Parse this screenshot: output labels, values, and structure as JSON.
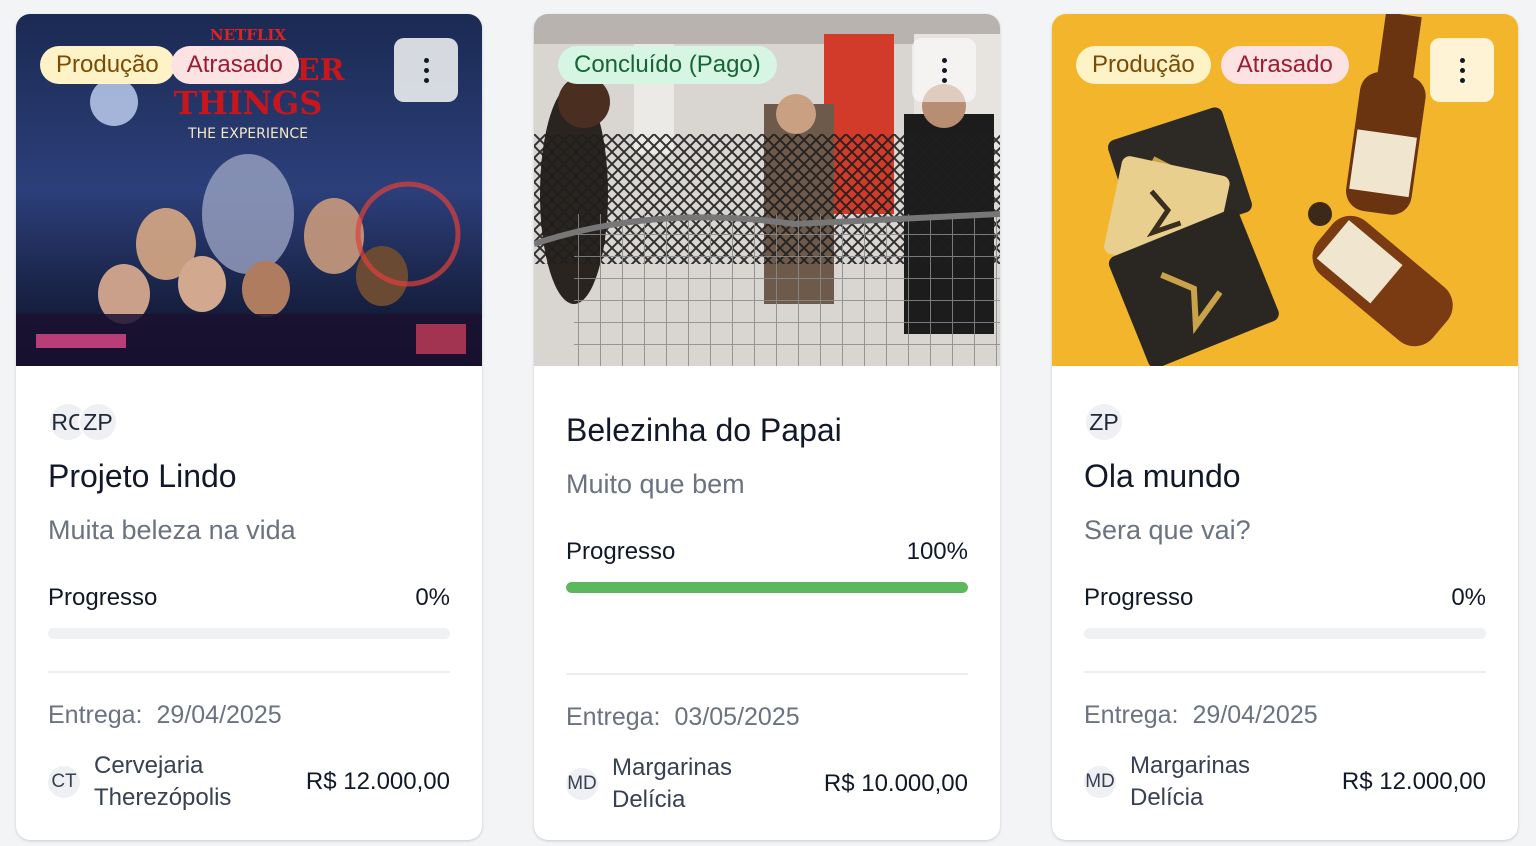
{
  "colors": {
    "badge_production_bg": "#fef3c7",
    "badge_production_fg": "#7c4a03",
    "badge_late_bg": "#fde2e4",
    "badge_late_fg": "#9b1c31",
    "badge_done_bg": "#d6f5e3",
    "badge_done_fg": "#166534",
    "progress_fill": "#5cb85c"
  },
  "progress_label": "Progresso",
  "delivery_label": "Entrega:",
  "cards": [
    {
      "image": "stranger-things-poster",
      "badges": [
        "Produção",
        "Atrasado"
      ],
      "avatars": [
        "RC",
        "ZP"
      ],
      "title": "Projeto Lindo",
      "subtitle": "Muita beleza na vida",
      "progress_text": "0%",
      "progress_value": 0,
      "delivery_date": "29/04/2025",
      "client_initials": "CT",
      "client_name": "Cervejaria Therezópolis",
      "price": "R$ 12.000,00"
    },
    {
      "image": "people-with-net-photo",
      "badges": [
        "Concluído (Pago)"
      ],
      "avatars": [],
      "title": "Belezinha do Papai",
      "subtitle": "Muito que bem",
      "progress_text": "100%",
      "progress_value": 1.0,
      "delivery_date": "03/05/2025",
      "client_initials": "MD",
      "client_name": "Margarinas Delícia",
      "price": "R$ 10.000,00"
    },
    {
      "image": "beer-bottles-photo",
      "badges": [
        "Produção",
        "Atrasado"
      ],
      "avatars": [
        "ZP"
      ],
      "title": "Ola mundo",
      "subtitle": "Sera que vai?",
      "progress_text": "0%",
      "progress_value": 0,
      "delivery_date": "29/04/2025",
      "client_initials": "MD",
      "client_name": "Margarinas Delícia",
      "price": "R$ 12.000,00"
    }
  ]
}
